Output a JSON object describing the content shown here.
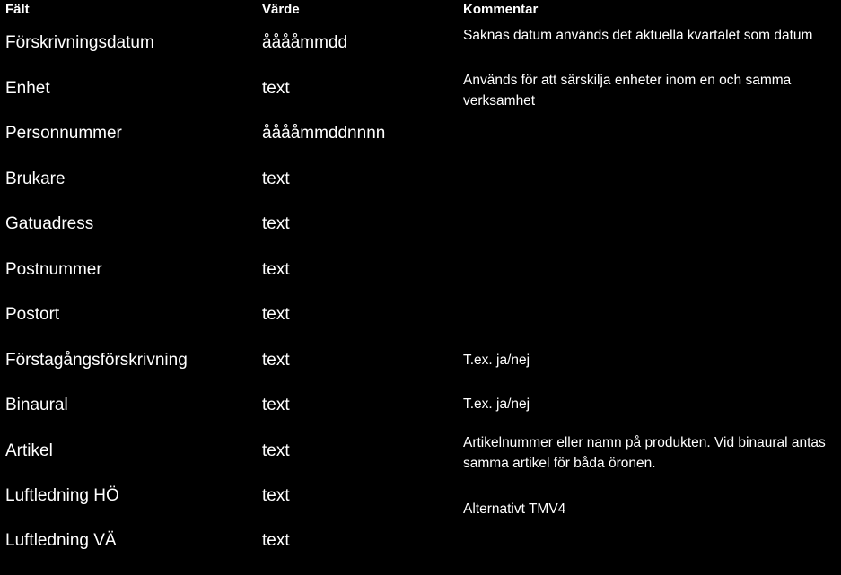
{
  "table": {
    "headers": {
      "field": "Fält",
      "value": "Värde",
      "comment": "Kommentar"
    },
    "rows": [
      {
        "field": "Förskrivningsdatum",
        "value": "ååååmmdd",
        "comment": "Saknas datum används det aktuella kvartalet som datum"
      },
      {
        "field": "Enhet",
        "value": "text",
        "comment": "Används för att särskilja enheter inom en och samma verksamhet"
      },
      {
        "field": "Personnummer",
        "value": "ååååmmddnnnn",
        "comment": ""
      },
      {
        "field": "Brukare",
        "value": "text",
        "comment": ""
      },
      {
        "field": "Gatuadress",
        "value": "text",
        "comment": ""
      },
      {
        "field": "Postnummer",
        "value": "text",
        "comment": ""
      },
      {
        "field": "Postort",
        "value": "text",
        "comment": ""
      },
      {
        "field": "Förstagångsförskrivning",
        "value": "text",
        "comment": "T.ex. ja/nej"
      },
      {
        "field": "Binaural",
        "value": "text",
        "comment": "T.ex. ja/nej"
      },
      {
        "field": "Artikel",
        "value": "text",
        "comment": "Artikelnummer eller namn på produkten. Vid binaural antas samma artikel för båda öronen."
      },
      {
        "field": "Luftledning HÖ",
        "value": "text",
        "comment": "Alternativt TMV4"
      },
      {
        "field": "Luftledning VÄ",
        "value": "text",
        "comment": ""
      }
    ]
  }
}
